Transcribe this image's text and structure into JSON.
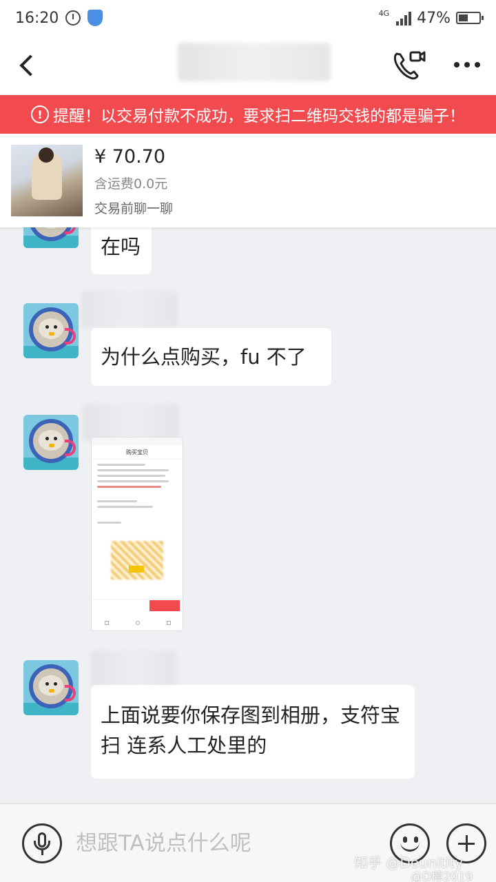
{
  "status_bar": {
    "time": "16:20",
    "network": "4G",
    "battery": "47%",
    "battery_level": 0.47
  },
  "header": {
    "back_icon": "chevron-left-icon",
    "call_icon": "phone-video-icon",
    "more_icon": "more-dots-icon"
  },
  "warning": {
    "icon": "!",
    "text": "提醒！以交易付款不成功，要求扫二维码交钱的都是骗子！"
  },
  "product": {
    "price": "¥ 70.70",
    "shipping": "含运费0.0元",
    "chat_label": "交易前聊一聊"
  },
  "messages": [
    {
      "text": "在吗"
    },
    {
      "text": "为什么点购买，fu 不了"
    },
    {
      "type": "image",
      "title": "购买宝贝"
    },
    {
      "text": "上面说要你保存图到相册，支符宝 扫 连系人工处里的"
    }
  ],
  "input": {
    "placeholder": "想跟TA说点什么呢"
  },
  "watermark": {
    "line1": "知乎 @Deunitity",
    "line2": "@D檸2019"
  }
}
